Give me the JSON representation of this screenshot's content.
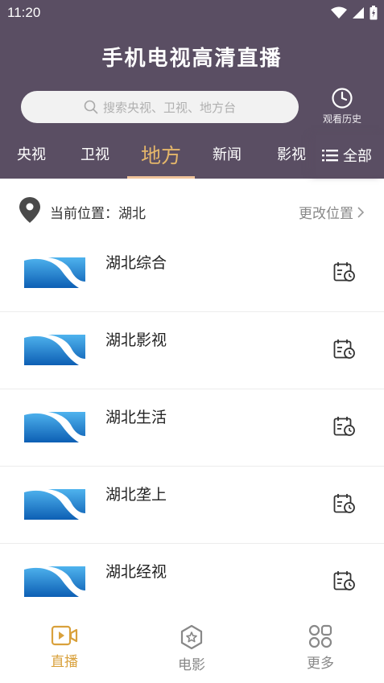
{
  "status": {
    "time": "11:20"
  },
  "app": {
    "title": "手机电视高清直播"
  },
  "search": {
    "placeholder": "搜索央视、卫视、地方台"
  },
  "history": {
    "label": "观看历史"
  },
  "tabs": [
    {
      "label": "央视"
    },
    {
      "label": "卫视"
    },
    {
      "label": "地方"
    },
    {
      "label": "新闻"
    },
    {
      "label": "影视"
    }
  ],
  "tab_all": {
    "label": "全部"
  },
  "location": {
    "text": "当前位置：湖北",
    "change_label": "更改位置"
  },
  "channels": [
    {
      "name": "湖北综合"
    },
    {
      "name": "湖北影视"
    },
    {
      "name": "湖北生活"
    },
    {
      "name": "湖北垄上"
    },
    {
      "name": "湖北经视"
    }
  ],
  "bottom_nav": [
    {
      "label": "直播"
    },
    {
      "label": "电影"
    },
    {
      "label": "更多"
    }
  ],
  "colors": {
    "header_bg": "#5a4e63",
    "accent": "#e4b66a",
    "nav_active": "#d9a13c"
  }
}
